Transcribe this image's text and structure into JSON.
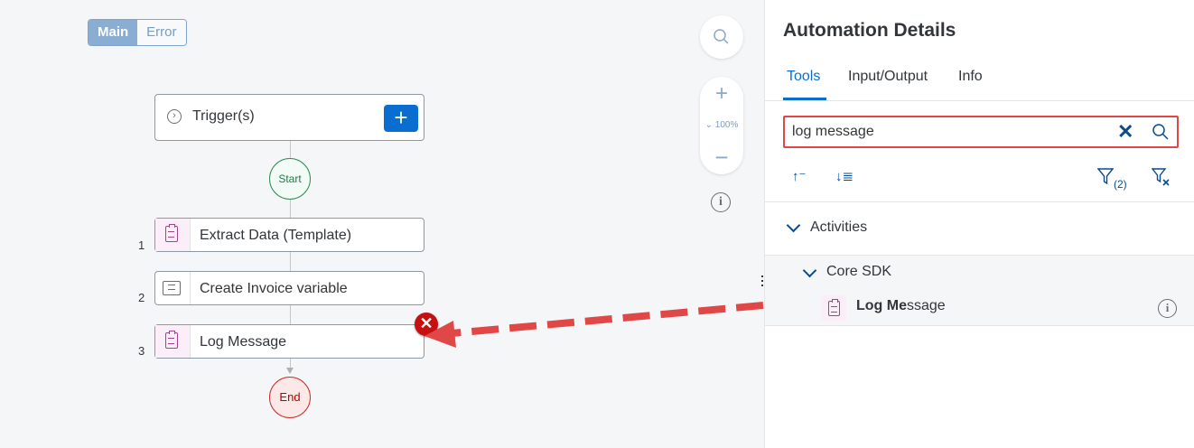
{
  "canvas": {
    "toggle": {
      "main_label": "Main",
      "error_label": "Error"
    },
    "trigger": {
      "label": "Trigger(s)",
      "add_label": "+"
    },
    "start_label": "Start",
    "end_label": "End",
    "steps": [
      {
        "number": "1",
        "label": "Extract Data (Template)"
      },
      {
        "number": "2",
        "label": "Create Invoice variable"
      },
      {
        "number": "3",
        "label": "Log Message"
      }
    ],
    "zoom": {
      "in_label": "+",
      "level": "⌄ 100%",
      "out_label": "−",
      "info_label": "i"
    },
    "error_badge": "✕"
  },
  "panel": {
    "title": "Automation Details",
    "tabs": [
      "Tools",
      "Input/Output",
      "Info"
    ],
    "search": {
      "value": "log message",
      "clear_label": "✕"
    },
    "tools": {
      "sort_asc": "↑⁻",
      "sort_desc": "↓≣",
      "filter_label": "(2)"
    },
    "section": {
      "label": "Activities"
    },
    "subsection": {
      "label": "Core SDK"
    },
    "item": {
      "label_bold": "Log Me",
      "label_rest": "ssage",
      "info_label": "i"
    }
  },
  "colors": {
    "accent": "#0a6ed1",
    "error": "#c80f0f",
    "annotation": "#e04848"
  }
}
